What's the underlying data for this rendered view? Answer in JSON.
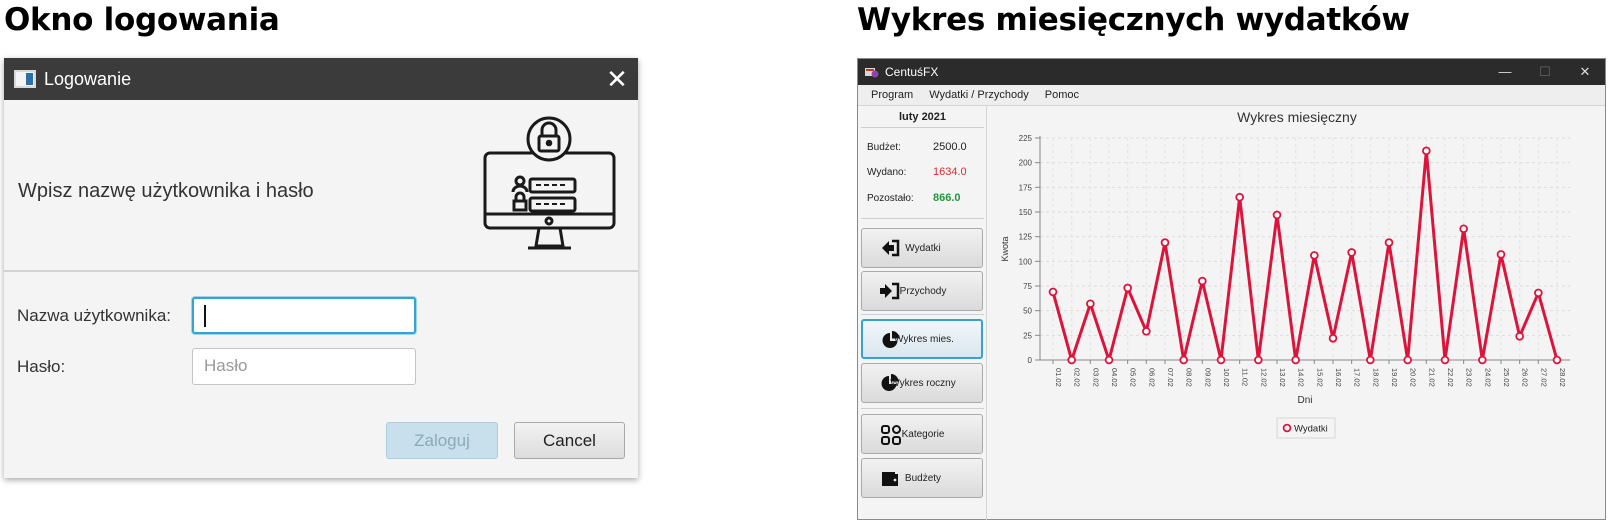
{
  "headings": {
    "left": "Okno logowania",
    "right": "Wykres miesięcznych wydatków"
  },
  "login": {
    "window_title": "Logowanie",
    "close_glyph": "✕",
    "prompt": "Wpisz nazwę użytkownika i hasło",
    "username_label": "Nazwa użytkownika:",
    "username_value": "",
    "password_label": "Hasło:",
    "password_placeholder": "Hasło",
    "login_button": "Zaloguj",
    "cancel_button": "Cancel",
    "illustration_icon": "monitor-lock-icon",
    "focus_color": "#3a9fd3"
  },
  "app": {
    "window_title": "CentuśFX",
    "window_controls": [
      "—",
      "☐",
      "✕"
    ],
    "menu": [
      "Program",
      "Wydatki / Przychody",
      "Pomoc"
    ],
    "sidebar": {
      "month": "luty 2021",
      "stats": [
        {
          "label": "Budżet:",
          "value": "2500.0",
          "color": "#222222"
        },
        {
          "label": "Wydano:",
          "value": "1634.0",
          "color": "#d32f2f"
        },
        {
          "label": "Pozostało:",
          "value": "866.0",
          "color": "#1e9a3a"
        }
      ],
      "buttons": [
        {
          "label": "Wydatki",
          "icon": "sign-out-icon",
          "active": false
        },
        {
          "label": "Przychody",
          "icon": "sign-in-icon",
          "active": false
        },
        {
          "label": "Wykres mies.",
          "icon": "pie-chart-icon",
          "active": true
        },
        {
          "label": "Wykres roczny",
          "icon": "pie-chart-icon",
          "active": false
        },
        {
          "label": "Kategorie",
          "icon": "grid-icon",
          "active": false
        },
        {
          "label": "Budżety",
          "icon": "wallet-icon",
          "active": false
        }
      ]
    }
  },
  "chart_data": {
    "type": "line",
    "title": "Wykres miesięczny",
    "xlabel": "Dni",
    "ylabel": "Kwota",
    "ylim": [
      0,
      225
    ],
    "yticks": [
      0,
      25,
      50,
      75,
      100,
      125,
      150,
      175,
      200,
      225
    ],
    "grid": true,
    "legend_position": "bottom-center",
    "categories": [
      "01.02",
      "02.02",
      "03.02",
      "04.02",
      "05.02",
      "06.02",
      "07.02",
      "08.02",
      "09.02",
      "10.02",
      "11.02",
      "12.02",
      "13.02",
      "14.02",
      "15.02",
      "16.02",
      "17.02",
      "18.02",
      "19.02",
      "20.02",
      "21.02",
      "22.02",
      "23.02",
      "24.02",
      "25.02",
      "26.02",
      "27.02",
      "28.02"
    ],
    "series": [
      {
        "name": "Wydatki",
        "color": "#dc143c",
        "values": [
          69,
          0,
          57,
          0,
          73,
          29,
          119,
          0,
          80,
          0,
          165,
          0,
          147,
          0,
          106,
          22,
          109,
          0,
          119,
          0,
          212,
          0,
          133,
          0,
          107,
          24,
          68,
          0
        ]
      }
    ]
  }
}
